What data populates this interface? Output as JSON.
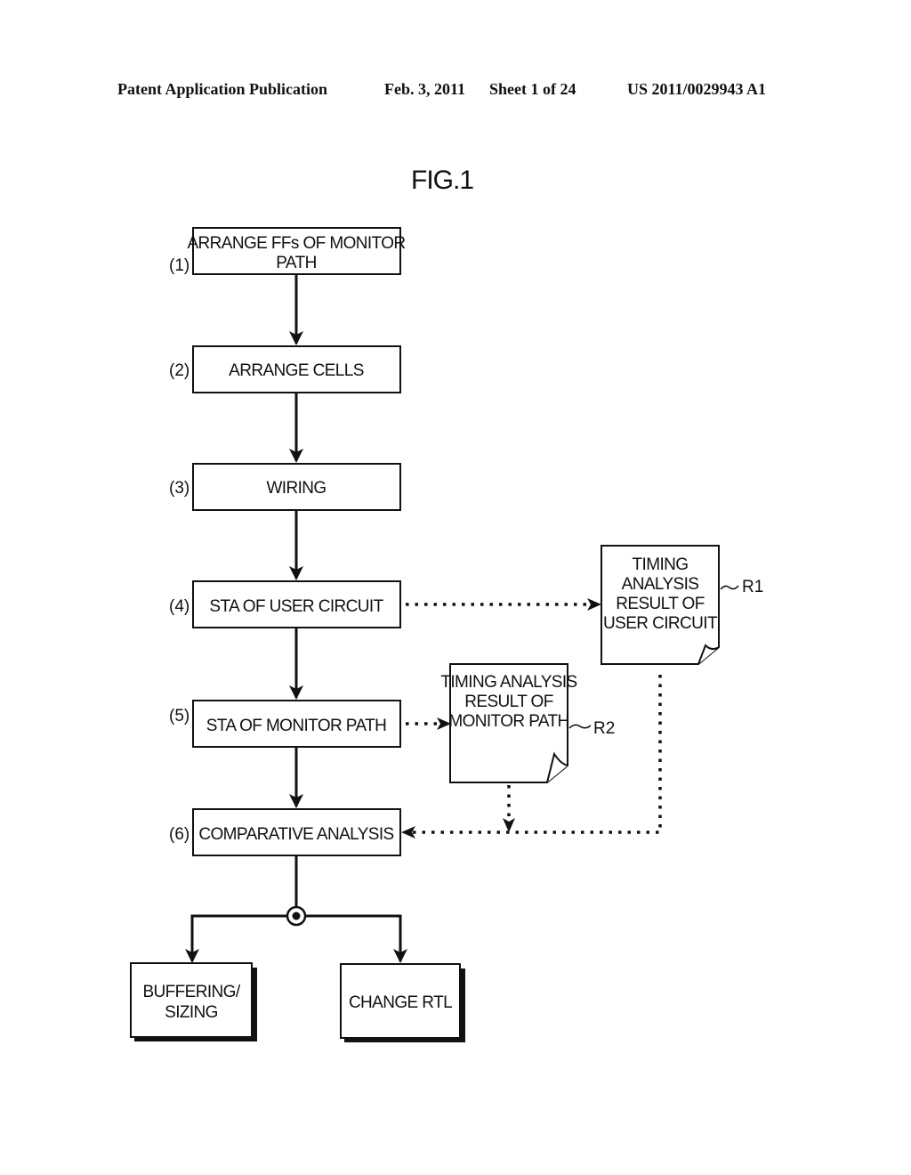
{
  "header": {
    "publication": "Patent Application Publication",
    "date": "Feb. 3, 2011",
    "sheet": "Sheet 1 of 24",
    "number": "US 2011/0029943 A1"
  },
  "figure": {
    "title": "FIG.1",
    "steps": [
      {
        "label": "(1)",
        "lines": [
          "ARRANGE FFs OF MONITOR",
          "PATH"
        ]
      },
      {
        "label": "(2)",
        "lines": [
          "ARRANGE CELLS"
        ]
      },
      {
        "label": "(3)",
        "lines": [
          "WIRING"
        ]
      },
      {
        "label": "(4)",
        "lines": [
          "STA OF USER CIRCUIT"
        ]
      },
      {
        "label": "(5)",
        "lines": [
          "STA OF MONITOR PATH"
        ]
      },
      {
        "label": "(6)",
        "lines": [
          "COMPARATIVE ANALYSIS"
        ]
      }
    ],
    "documents": [
      {
        "ref": "R1",
        "lines": [
          "TIMING",
          "ANALYSIS",
          "RESULT OF",
          "USER CIRCUIT"
        ]
      },
      {
        "ref": "R2",
        "lines": [
          "TIMING ANALYSIS",
          "RESULT OF",
          "MONITOR PATH"
        ]
      }
    ],
    "outcomes": [
      {
        "lines": [
          "BUFFERING/",
          "SIZING"
        ]
      },
      {
        "lines": [
          "CHANGE RTL"
        ]
      }
    ]
  }
}
